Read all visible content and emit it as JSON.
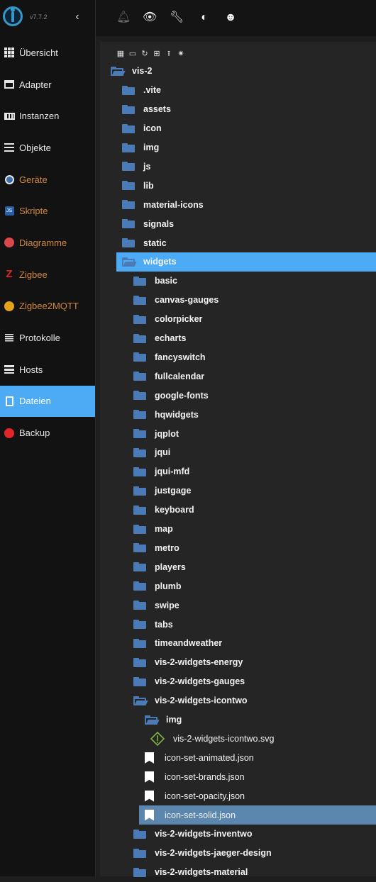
{
  "app": {
    "version": "v7.7.2"
  },
  "sidebar": {
    "items": [
      {
        "label": "Übersicht",
        "icon": "grid-icon",
        "style": "normal"
      },
      {
        "label": "Adapter",
        "icon": "store-icon",
        "style": "normal"
      },
      {
        "label": "Instanzen",
        "icon": "keyboard-icon",
        "style": "normal"
      },
      {
        "label": "Objekte",
        "icon": "list-icon",
        "style": "normal"
      },
      {
        "label": "Geräte",
        "icon": "devices-icon",
        "style": "adapter"
      },
      {
        "label": "Skripte",
        "icon": "javascript-icon",
        "style": "adapter"
      },
      {
        "label": "Diagramme",
        "icon": "chart-icon",
        "style": "adapter"
      },
      {
        "label": "Zigbee",
        "icon": "zigbee-icon",
        "style": "adapter"
      },
      {
        "label": "Zigbee2MQTT",
        "icon": "zigbee2mqtt-icon",
        "style": "adapter"
      },
      {
        "label": "Protokolle",
        "icon": "log-icon",
        "style": "normal"
      },
      {
        "label": "Hosts",
        "icon": "hosts-icon",
        "style": "normal"
      },
      {
        "label": "Dateien",
        "icon": "file-icon",
        "style": "active"
      },
      {
        "label": "Backup",
        "icon": "backup-icon",
        "style": "normal"
      }
    ]
  },
  "toolbar": {
    "icons": [
      "bell-icon",
      "eye-icon",
      "wrench-icon",
      "theme-icon",
      "expert-mode-icon"
    ]
  },
  "file_browser": {
    "tools": [
      "tile-view-icon",
      "folder-icon",
      "refresh-icon",
      "add-folder-icon",
      "upload-icon",
      "brightness-icon"
    ],
    "tree": [
      {
        "name": "vis-2",
        "type": "folder",
        "open": true,
        "level": 0
      },
      {
        "name": ".vite",
        "type": "folder",
        "level": 1
      },
      {
        "name": "assets",
        "type": "folder",
        "level": 1
      },
      {
        "name": "icon",
        "type": "folder",
        "level": 1
      },
      {
        "name": "img",
        "type": "folder",
        "level": 1
      },
      {
        "name": "js",
        "type": "folder",
        "level": 1
      },
      {
        "name": "lib",
        "type": "folder",
        "level": 1
      },
      {
        "name": "material-icons",
        "type": "folder",
        "level": 1
      },
      {
        "name": "signals",
        "type": "folder",
        "level": 1
      },
      {
        "name": "static",
        "type": "folder",
        "level": 1
      },
      {
        "name": "widgets",
        "type": "folder",
        "open": true,
        "level": 1,
        "selected": "folder"
      },
      {
        "name": "basic",
        "type": "folder",
        "level": 2
      },
      {
        "name": "canvas-gauges",
        "type": "folder",
        "level": 2
      },
      {
        "name": "colorpicker",
        "type": "folder",
        "level": 2
      },
      {
        "name": "echarts",
        "type": "folder",
        "level": 2
      },
      {
        "name": "fancyswitch",
        "type": "folder",
        "level": 2
      },
      {
        "name": "fullcalendar",
        "type": "folder",
        "level": 2
      },
      {
        "name": "google-fonts",
        "type": "folder",
        "level": 2
      },
      {
        "name": "hqwidgets",
        "type": "folder",
        "level": 2
      },
      {
        "name": "jqplot",
        "type": "folder",
        "level": 2
      },
      {
        "name": "jqui",
        "type": "folder",
        "level": 2
      },
      {
        "name": "jqui-mfd",
        "type": "folder",
        "level": 2
      },
      {
        "name": "justgage",
        "type": "folder",
        "level": 2
      },
      {
        "name": "keyboard",
        "type": "folder",
        "level": 2
      },
      {
        "name": "map",
        "type": "folder",
        "level": 2
      },
      {
        "name": "metro",
        "type": "folder",
        "level": 2
      },
      {
        "name": "players",
        "type": "folder",
        "level": 2
      },
      {
        "name": "plumb",
        "type": "folder",
        "level": 2
      },
      {
        "name": "swipe",
        "type": "folder",
        "level": 2
      },
      {
        "name": "tabs",
        "type": "folder",
        "level": 2
      },
      {
        "name": "timeandweather",
        "type": "folder",
        "level": 2
      },
      {
        "name": "vis-2-widgets-energy",
        "type": "folder",
        "level": 2
      },
      {
        "name": "vis-2-widgets-gauges",
        "type": "folder",
        "level": 2
      },
      {
        "name": "vis-2-widgets-icontwo",
        "type": "folder",
        "open": true,
        "level": 2
      },
      {
        "name": "img",
        "type": "folder",
        "open": true,
        "level": 3
      },
      {
        "name": "vis-2-widgets-icontwo.svg",
        "type": "svg",
        "level": 4
      },
      {
        "name": "icon-set-animated.json",
        "type": "file",
        "level": 3
      },
      {
        "name": "icon-set-brands.json",
        "type": "file",
        "level": 3
      },
      {
        "name": "icon-set-opacity.json",
        "type": "file",
        "level": 3
      },
      {
        "name": "icon-set-solid.json",
        "type": "file",
        "level": 3,
        "selected": "file"
      },
      {
        "name": "vis-2-widgets-inventwo",
        "type": "folder",
        "level": 2
      },
      {
        "name": "vis-2-widgets-jaeger-design",
        "type": "folder",
        "level": 2
      },
      {
        "name": "vis-2-widgets-material",
        "type": "folder",
        "level": 2
      }
    ]
  }
}
